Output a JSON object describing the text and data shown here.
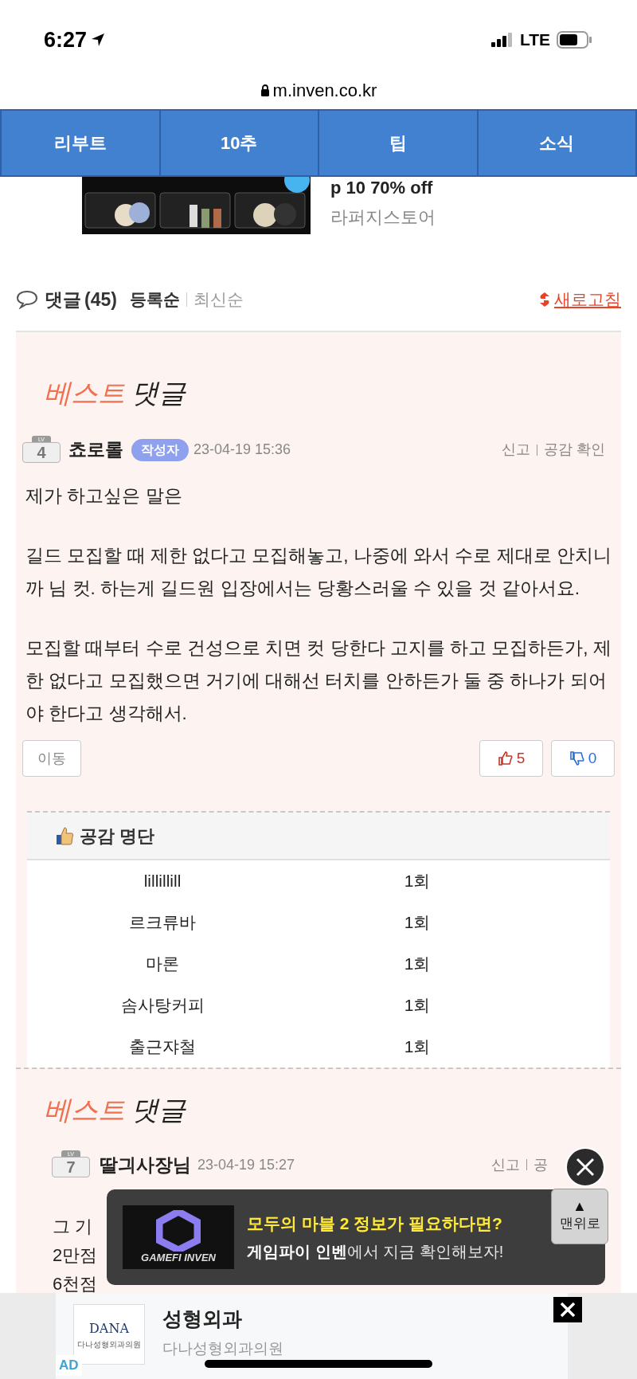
{
  "status_bar": {
    "time": "6:27",
    "network": "LTE"
  },
  "address_bar": {
    "url": "m.inven.co.kr"
  },
  "nav_tabs": [
    {
      "label": "리부트"
    },
    {
      "label": "10추"
    },
    {
      "label": "팁"
    },
    {
      "label": "소식"
    }
  ],
  "top_ad": {
    "headline": "p 10 70% off",
    "advertiser": "라퍼지스토어"
  },
  "comments_header": {
    "title": "댓글",
    "count": "(45)",
    "sort": [
      {
        "label": "등록순",
        "selected": true
      },
      {
        "label": "최신순",
        "selected": false
      }
    ],
    "refresh": "새로고침"
  },
  "best_comments": [
    {
      "heading": [
        "베스트",
        "댓글"
      ],
      "level": "4",
      "level_prefix": "LV",
      "author": "쵸로롤",
      "author_badge": "작성자",
      "time": "23-04-19 15:36",
      "actions": [
        "신고",
        "공감 확인"
      ],
      "paragraphs": [
        "제가 하고싶은 말은",
        "길드 모집할 때 제한 없다고 모집해놓고, 나중에 와서 수로 제대로 안치니까 님 컷. 하는게 길드원 입장에서는 당황스러울 수 있을 것 같아서요.",
        "모집할 때부터 수로 건성으로 치면 컷 당한다 고지를 하고 모집하든가, 제한 없다고 모집했으면 거기에 대해선 터치를 안하든가 둘 중 하나가 되어야 한다고 생각해서."
      ],
      "move_button": "이동",
      "likes": "5",
      "dislikes": "0",
      "like_list": {
        "title": "공감 명단",
        "rows": [
          {
            "name": "lillillill",
            "count": "1회"
          },
          {
            "name": "르크류바",
            "count": "1회"
          },
          {
            "name": "마론",
            "count": "1회"
          },
          {
            "name": "솜사탕커피",
            "count": "1회"
          },
          {
            "name": "출근쟈철",
            "count": "1회"
          }
        ]
      }
    },
    {
      "heading": [
        "베스트",
        "댓글"
      ],
      "level": "7",
      "level_prefix": "LV",
      "author": "딸긔사장님",
      "time": "23-04-19 15:27",
      "actions": [
        "신고",
        "공"
      ],
      "lines": [
        "그 기",
        "2만점",
        "6천점"
      ]
    }
  ],
  "popup": {
    "logo": "GAMEFI INVEN",
    "title": "모두의 마블 2 정보가 필요하다면?",
    "text": "**게임파이 인벤**에서 지금 확인해보자!"
  },
  "top_button": {
    "arrow": "▲",
    "label": "맨위로"
  },
  "bottom_ad": {
    "logo": "DANA",
    "logo_caption": "다나성형외과의원",
    "title": "성형외과",
    "advertiser": "다나성형외과의원",
    "tag": "AD"
  }
}
